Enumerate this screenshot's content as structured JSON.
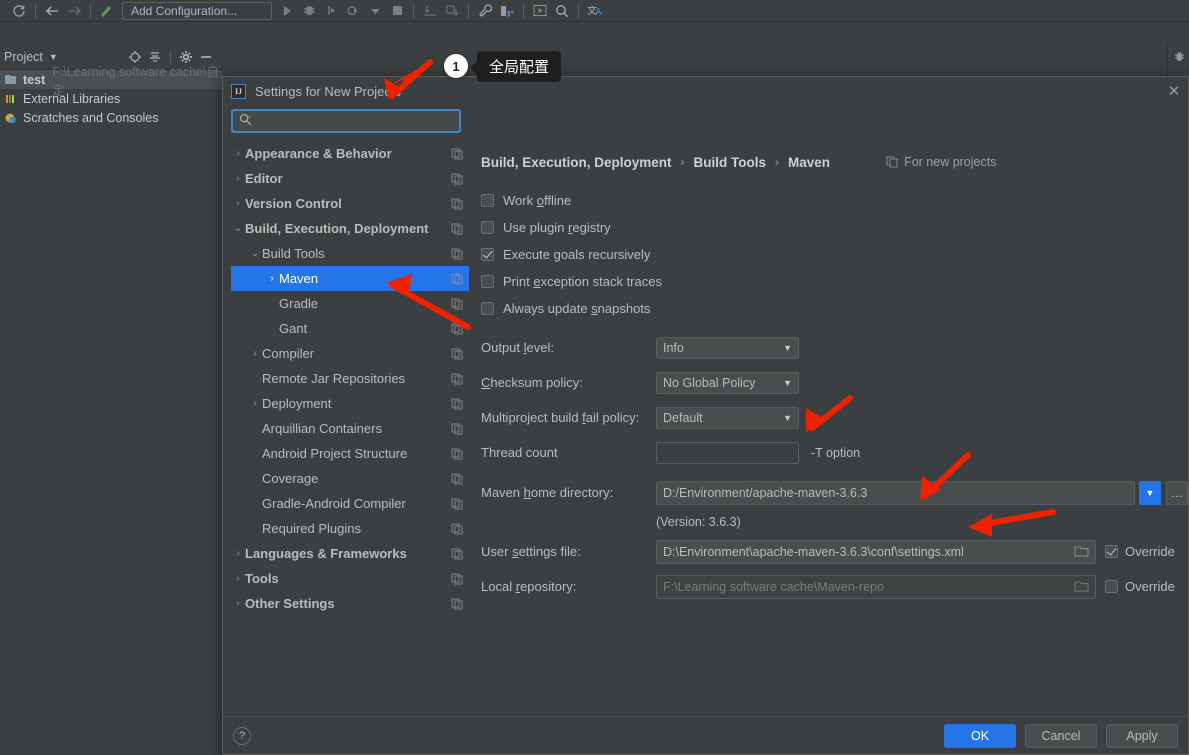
{
  "ide": {
    "toolbar": {
      "run_config_label": "Add Configuration...",
      "icons": [
        "sync-icon",
        "back-arrow-icon",
        "forward-arrow-icon",
        "build-hammer-icon",
        "run-icon",
        "debug-icon",
        "run-with-coverage-icon",
        "profile-icon",
        "dropdown-caret-icon",
        "stop-icon",
        "update-project-icon",
        "commit-icon",
        "settings-wrench-icon",
        "project-structure-icon",
        "run-anything-icon",
        "search-everywhere-icon",
        "translate-icon"
      ]
    },
    "project_panel": {
      "title": "Project",
      "action_icons": [
        "locate-icon",
        "collapse-all-icon",
        "gear-icon",
        "hide-icon"
      ],
      "tree": [
        {
          "name": "test",
          "path": "F:\\Learning software cache\\自定",
          "icon": "module-icon",
          "selected": true
        },
        {
          "name": "External Libraries",
          "path": "",
          "icon": "libraries-icon",
          "selected": false
        },
        {
          "name": "Scratches and Consoles",
          "path": "",
          "icon": "scratches-icon",
          "selected": false
        }
      ]
    },
    "right_strip_icons": [
      "bug-icon",
      "run-tool-icon"
    ]
  },
  "dialog": {
    "title": "Settings for New Projects",
    "logo": "intellij-idea-logo-icon",
    "close_icon": "close-icon",
    "search": {
      "placeholder": "",
      "value": "",
      "icon": "search-icon"
    },
    "tree": [
      {
        "label": "Appearance & Behavior",
        "level": 0,
        "arrow": "collapsed",
        "bold": true,
        "selected": false,
        "copy": true
      },
      {
        "label": "Editor",
        "level": 0,
        "arrow": "collapsed",
        "bold": true,
        "selected": false,
        "copy": true
      },
      {
        "label": "Version Control",
        "level": 0,
        "arrow": "collapsed",
        "bold": true,
        "selected": false,
        "copy": true
      },
      {
        "label": "Build, Execution, Deployment",
        "level": 0,
        "arrow": "expanded",
        "bold": true,
        "selected": false,
        "copy": true
      },
      {
        "label": "Build Tools",
        "level": 1,
        "arrow": "expanded",
        "bold": false,
        "selected": false,
        "copy": true
      },
      {
        "label": "Maven",
        "level": 2,
        "arrow": "collapsed",
        "bold": false,
        "selected": true,
        "copy": true
      },
      {
        "label": "Gradle",
        "level": 2,
        "arrow": "none",
        "bold": false,
        "selected": false,
        "copy": true
      },
      {
        "label": "Gant",
        "level": 2,
        "arrow": "none",
        "bold": false,
        "selected": false,
        "copy": true
      },
      {
        "label": "Compiler",
        "level": 1,
        "arrow": "collapsed",
        "bold": false,
        "selected": false,
        "copy": true
      },
      {
        "label": "Remote Jar Repositories",
        "level": 1,
        "arrow": "none",
        "bold": false,
        "selected": false,
        "copy": true
      },
      {
        "label": "Deployment",
        "level": 1,
        "arrow": "collapsed",
        "bold": false,
        "selected": false,
        "copy": true
      },
      {
        "label": "Arquillian Containers",
        "level": 1,
        "arrow": "none",
        "bold": false,
        "selected": false,
        "copy": true
      },
      {
        "label": "Android Project Structure",
        "level": 1,
        "arrow": "none",
        "bold": false,
        "selected": false,
        "copy": true
      },
      {
        "label": "Coverage",
        "level": 1,
        "arrow": "none",
        "bold": false,
        "selected": false,
        "copy": true
      },
      {
        "label": "Gradle-Android Compiler",
        "level": 1,
        "arrow": "none",
        "bold": false,
        "selected": false,
        "copy": true
      },
      {
        "label": "Required Plugins",
        "level": 1,
        "arrow": "none",
        "bold": false,
        "selected": false,
        "copy": true
      },
      {
        "label": "Languages & Frameworks",
        "level": 0,
        "arrow": "collapsed",
        "bold": true,
        "selected": false,
        "copy": true
      },
      {
        "label": "Tools",
        "level": 0,
        "arrow": "collapsed",
        "bold": true,
        "selected": false,
        "copy": true
      },
      {
        "label": "Other Settings",
        "level": 0,
        "arrow": "collapsed",
        "bold": true,
        "selected": false,
        "copy": true
      }
    ],
    "breadcrumbs": [
      "Build, Execution, Deployment",
      "Build Tools",
      "Maven"
    ],
    "for_new_projects": "For new projects",
    "checkboxes": [
      {
        "label": "Work offline",
        "checked": false
      },
      {
        "label": "Use plugin registry",
        "checked": false
      },
      {
        "label": "Execute goals recursively",
        "checked": true
      },
      {
        "label": "Print exception stack traces",
        "checked": false
      },
      {
        "label": "Always update snapshots",
        "checked": false
      }
    ],
    "fields": {
      "output_level": {
        "label": "Output level:",
        "value": "Info"
      },
      "checksum": {
        "label": "Checksum policy:",
        "value": "No Global Policy"
      },
      "fail_policy": {
        "label": "Multiproject build fail policy:",
        "value": "Default"
      },
      "thread_count": {
        "label": "Thread count",
        "value": "",
        "note": "-T option"
      },
      "maven_home": {
        "label": "Maven home directory:",
        "value": "D:/Environment/apache-maven-3.6.3"
      },
      "version_note": "(Version: 3.6.3)",
      "user_settings": {
        "label": "User settings file:",
        "value": "D:\\Environment\\apache-maven-3.6.3\\conf\\settings.xml",
        "override_label": "Override",
        "override": true
      },
      "local_repo": {
        "label": "Local repository:",
        "value": "F:\\Learning software cache\\Maven-repo",
        "placeholder_style": true,
        "override_label": "Override",
        "override": false
      }
    },
    "footer": {
      "help": "?",
      "ok": "OK",
      "cancel": "Cancel",
      "apply": "Apply"
    }
  },
  "annotations": {
    "badge_1": "1",
    "tooltip_1": "全局配置",
    "arrow_color": "#ee2200"
  }
}
